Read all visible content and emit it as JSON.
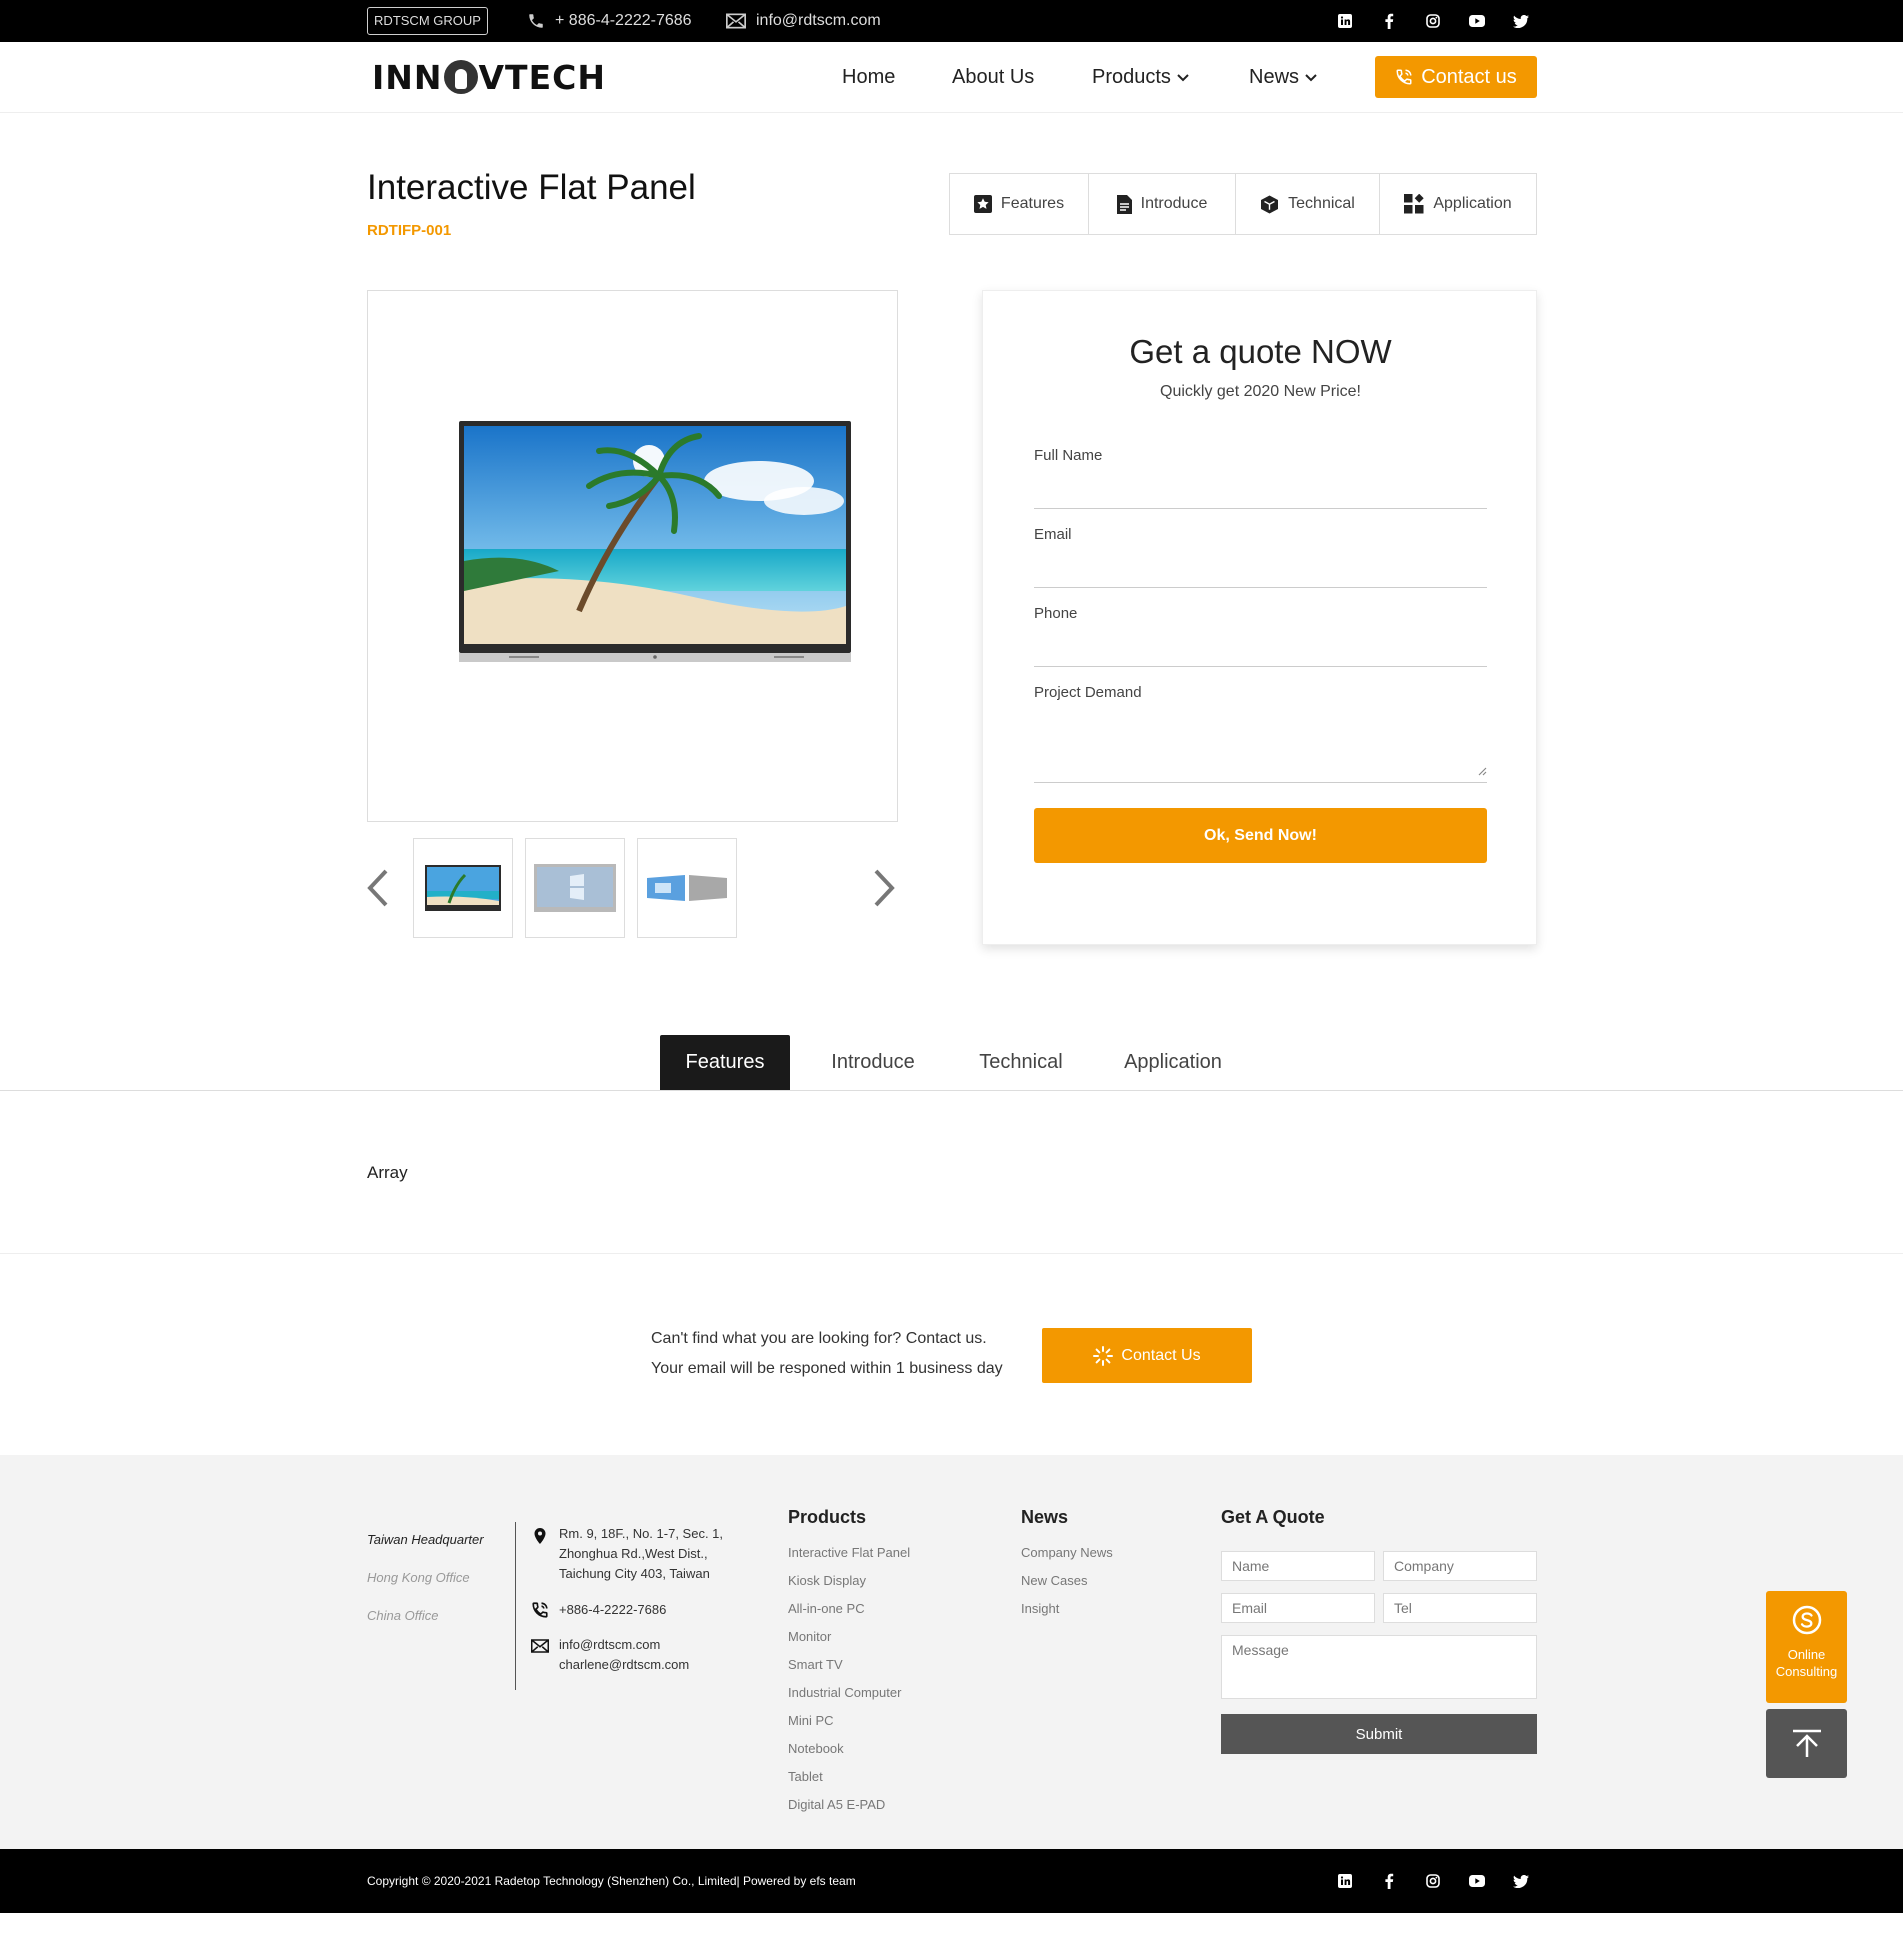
{
  "topbar": {
    "group": "RDTSCM GROUP",
    "phone": "+ 886-4-2222-7686",
    "email": "info@rdtscm.com",
    "social": [
      "linkedin-icon",
      "facebook-icon",
      "instagram-icon",
      "youtube-icon",
      "twitter-icon"
    ]
  },
  "header": {
    "logo_left": "INN",
    "logo_right": "VTECH",
    "nav": [
      {
        "label": "Home",
        "dropdown": false
      },
      {
        "label": "About Us",
        "dropdown": false
      },
      {
        "label": "Products",
        "dropdown": true
      },
      {
        "label": "News",
        "dropdown": true
      }
    ],
    "contact_label": "Contact us",
    "accent": "#f39800"
  },
  "product": {
    "title": "Interactive Flat Panel",
    "sku": "RDTIFP-001"
  },
  "section_tabs": [
    "Features",
    "Introduce",
    "Technical",
    "Application"
  ],
  "quote": {
    "title": "Get a quote NOW",
    "subtitle": "Quickly get 2020 New Price!",
    "fields": [
      "Full Name",
      "Email",
      "Phone",
      "Project Demand"
    ],
    "submit": "Ok, Send Now!"
  },
  "detail": {
    "active_tab": "Features",
    "content": "Array"
  },
  "cta": {
    "line1": "Can't find what you are looking for? Contact us.",
    "line2": "Your email will be responed within 1 business day",
    "button": "Contact Us"
  },
  "footer": {
    "offices": [
      "Taiwan Headquarter",
      "Hong Kong Office",
      "China Office"
    ],
    "address": [
      "Rm. 9, 18F., No. 1-7, Sec. 1,",
      "Zhonghua Rd.,West Dist.,",
      "Taichung City 403, Taiwan"
    ],
    "phone": "+886-4-2222-7686",
    "emails": [
      "info@rdtscm.com",
      "charlene@rdtscm.com"
    ],
    "products_head": "Products",
    "products": [
      "Interactive Flat Panel",
      "Kiosk Display",
      "All-in-one PC",
      "Monitor",
      "Smart TV",
      "Industrial Computer",
      "Mini PC",
      "Notebook",
      "Tablet",
      "Digital A5 E-PAD"
    ],
    "news_head": "News",
    "news": [
      "Company News",
      "New Cases",
      "Insight"
    ],
    "quote_head": "Get A Quote",
    "quote_placeholders": {
      "name": "Name",
      "company": "Company",
      "email": "Email",
      "tel": "Tel",
      "message": "Message"
    },
    "submit": "Submit"
  },
  "floating": {
    "consult_line1": "Online",
    "consult_line2": "Consulting"
  },
  "bottom": {
    "copyright": "Copyright © 2020-2021 Radetop Technology (Shenzhen) Co., Limited| Powered by efs team"
  }
}
